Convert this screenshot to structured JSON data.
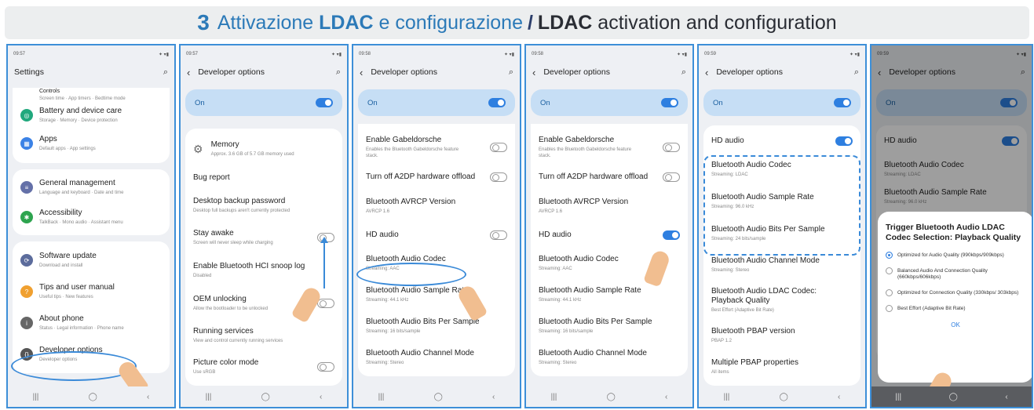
{
  "banner": {
    "number": "3",
    "it_prefix": "Attivazione ",
    "it_bold": "LDAC",
    "it_suffix": " e configurazione",
    "slash": "/",
    "en_bold": "LDAC",
    "en_suffix": " activation and configuration"
  },
  "phones": [
    {
      "time": "09:57",
      "title": "Settings",
      "items": [
        {
          "title": "Controls",
          "sub": "Screen time · App timers · Bedtime mode"
        },
        {
          "title": "Battery and device care",
          "sub": "Storage · Memory · Device protection",
          "color": "#21a87d"
        },
        {
          "title": "Apps",
          "sub": "Default apps · App settings",
          "color": "#3b82e6"
        },
        {
          "title": "General management",
          "sub": "Language and keyboard · Date and time",
          "color": "#6470a8"
        },
        {
          "title": "Accessibility",
          "sub": "TalkBack · Mono audio · Assistant menu",
          "color": "#2ea44f"
        },
        {
          "title": "Software update",
          "sub": "Download and install",
          "color": "#5c6c9c"
        },
        {
          "title": "Tips and user manual",
          "sub": "Useful tips · New features",
          "color": "#f0a030"
        },
        {
          "title": "About phone",
          "sub": "Status · Legal information · Phone name",
          "color": "#666"
        },
        {
          "title": "Developer options",
          "sub": "Developer options",
          "color": "#555"
        }
      ]
    },
    {
      "time": "09:57",
      "title": "Developer options",
      "on": "On",
      "items": [
        {
          "title": "Memory",
          "sub": "Approx. 3.6 GB of 5.7 GB memory used"
        },
        {
          "title": "Bug report",
          "sub": ""
        },
        {
          "title": "Desktop backup password",
          "sub": "Desktop full backups aren't currently protected"
        },
        {
          "title": "Stay awake",
          "sub": "Screen will never sleep while charging"
        },
        {
          "title": "Enable Bluetooth HCI snoop log",
          "sub": "Disabled"
        },
        {
          "title": "OEM unlocking",
          "sub": "Allow the bootloader to be unlocked"
        },
        {
          "title": "Running services",
          "sub": "View and control currently running services"
        },
        {
          "title": "Picture color mode",
          "sub": "Use sRGB"
        }
      ]
    },
    {
      "time": "09:58",
      "title": "Developer options",
      "on": "On",
      "items": [
        {
          "title": "Enable Gabeldorsche",
          "sub": "Enables the Bluetooth Gabeldorsche feature stack."
        },
        {
          "title": "Turn off A2DP hardware offload",
          "sub": ""
        },
        {
          "title": "Bluetooth AVRCP Version",
          "sub": "AVRCP 1.6"
        },
        {
          "title": "HD audio",
          "sub": ""
        },
        {
          "title": "Bluetooth Audio Codec",
          "sub": "Streaming: AAC"
        },
        {
          "title": "Bluetooth Audio Sample Rate",
          "sub": "Streaming: 44.1 kHz"
        },
        {
          "title": "Bluetooth Audio Bits Per Sample",
          "sub": "Streaming: 16 bits/sample"
        },
        {
          "title": "Bluetooth Audio Channel Mode",
          "sub": "Streaming: Stereo"
        }
      ]
    },
    {
      "time": "09:58",
      "title": "Developer options",
      "on": "On",
      "items": [
        {
          "title": "Enable Gabeldorsche",
          "sub": "Enables the Bluetooth Gabeldorsche feature stack."
        },
        {
          "title": "Turn off A2DP hardware offload",
          "sub": ""
        },
        {
          "title": "Bluetooth AVRCP Version",
          "sub": "AVRCP 1.6"
        },
        {
          "title": "HD audio",
          "sub": ""
        },
        {
          "title": "Bluetooth Audio Codec",
          "sub": "Streaming: AAC"
        },
        {
          "title": "Bluetooth Audio Sample Rate",
          "sub": "Streaming: 44.1 kHz"
        },
        {
          "title": "Bluetooth Audio Bits Per Sample",
          "sub": "Streaming: 16 bits/sample"
        },
        {
          "title": "Bluetooth Audio Channel Mode",
          "sub": "Streaming: Stereo"
        }
      ]
    },
    {
      "time": "09:59",
      "title": "Developer options",
      "on": "On",
      "items": [
        {
          "title": "HD audio",
          "sub": ""
        },
        {
          "title": "Bluetooth Audio Codec",
          "sub": "Streaming: LDAC"
        },
        {
          "title": "Bluetooth Audio Sample Rate",
          "sub": "Streaming: 96.0 kHz"
        },
        {
          "title": "Bluetooth Audio Bits Per Sample",
          "sub": "Streaming: 24 bits/sample"
        },
        {
          "title": "Bluetooth Audio Channel Mode",
          "sub": "Streaming: Stereo"
        },
        {
          "title": "Bluetooth Audio LDAC Codec: Playback Quality",
          "sub": "Best Effort (Adaptive Bit Rate)"
        },
        {
          "title": "Bluetooth PBAP version",
          "sub": "PBAP 1.2"
        },
        {
          "title": "Multiple PBAP properties",
          "sub": "All items"
        }
      ]
    },
    {
      "time": "09:59",
      "title": "Developer options",
      "on": "On",
      "items": [
        {
          "title": "HD audio",
          "sub": ""
        },
        {
          "title": "Bluetooth Audio Codec",
          "sub": "Streaming: LDAC"
        },
        {
          "title": "Bluetooth Audio Sample Rate",
          "sub": "Streaming: 96.0 kHz"
        }
      ],
      "dialog": {
        "title": "Trigger Bluetooth Audio LDAC Codec Selection: Playback Quality",
        "options": [
          "Optimized for Audio Quality (990kbps/909kbps)",
          "Balanced Audio And Connection Quality (660kbps/606kbps)",
          "Optimized for Connection Quality (330kbps/ 303kbps)",
          "Best Effort (Adaptive Bit Rate)"
        ],
        "ok": "OK"
      }
    }
  ],
  "nav": {
    "recent": "|||",
    "home": "◯",
    "back": "‹"
  }
}
